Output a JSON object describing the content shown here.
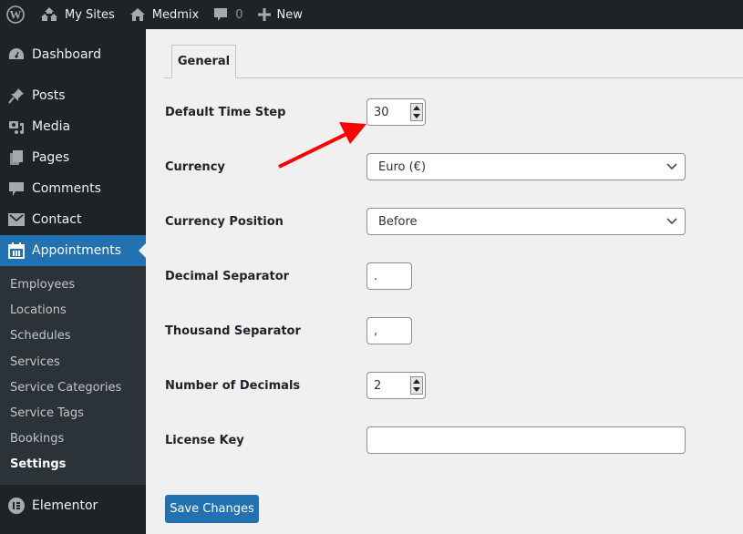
{
  "adminbar": {
    "items": [
      {
        "icon": "wordpress-logo-icon",
        "label": ""
      },
      {
        "icon": "my-sites-icon",
        "label": "My Sites"
      },
      {
        "icon": "home-icon",
        "label": "Medmix"
      },
      {
        "icon": "comment-icon",
        "label": "0"
      },
      {
        "icon": "plus-icon",
        "label": "New"
      }
    ]
  },
  "sidebar": {
    "items": [
      {
        "icon": "dashboard-icon",
        "label": "Dashboard"
      },
      {
        "icon": "pin-icon",
        "label": "Posts"
      },
      {
        "icon": "media-icon",
        "label": "Media"
      },
      {
        "icon": "pages-icon",
        "label": "Pages"
      },
      {
        "icon": "comments-icon",
        "label": "Comments"
      },
      {
        "icon": "envelope-icon",
        "label": "Contact"
      },
      {
        "icon": "calendar-icon",
        "label": "Appointments",
        "active": true
      }
    ],
    "submenu": [
      {
        "label": "Employees"
      },
      {
        "label": "Locations"
      },
      {
        "label": "Schedules"
      },
      {
        "label": "Services"
      },
      {
        "label": "Service Categories"
      },
      {
        "label": "Service Tags"
      },
      {
        "label": "Bookings"
      },
      {
        "label": "Settings",
        "current": true
      }
    ],
    "after": [
      {
        "icon": "elementor-icon",
        "label": "Elementor"
      }
    ]
  },
  "tabs": [
    {
      "label": "General",
      "active": true
    }
  ],
  "form": {
    "default_time_step": {
      "label": "Default Time Step",
      "value": "30"
    },
    "currency": {
      "label": "Currency",
      "value": "Euro (€)"
    },
    "currency_position": {
      "label": "Currency Position",
      "value": "Before"
    },
    "decimal_separator": {
      "label": "Decimal Separator",
      "value": "."
    },
    "thousand_separator": {
      "label": "Thousand Separator",
      "value": ","
    },
    "number_of_decimals": {
      "label": "Number of Decimals",
      "value": "2"
    },
    "license_key": {
      "label": "License Key",
      "value": ""
    }
  },
  "save_button": {
    "label": "Save Changes"
  },
  "annotation": {
    "type": "arrow",
    "color": "#ff0000",
    "points_to": "default_time_step"
  }
}
